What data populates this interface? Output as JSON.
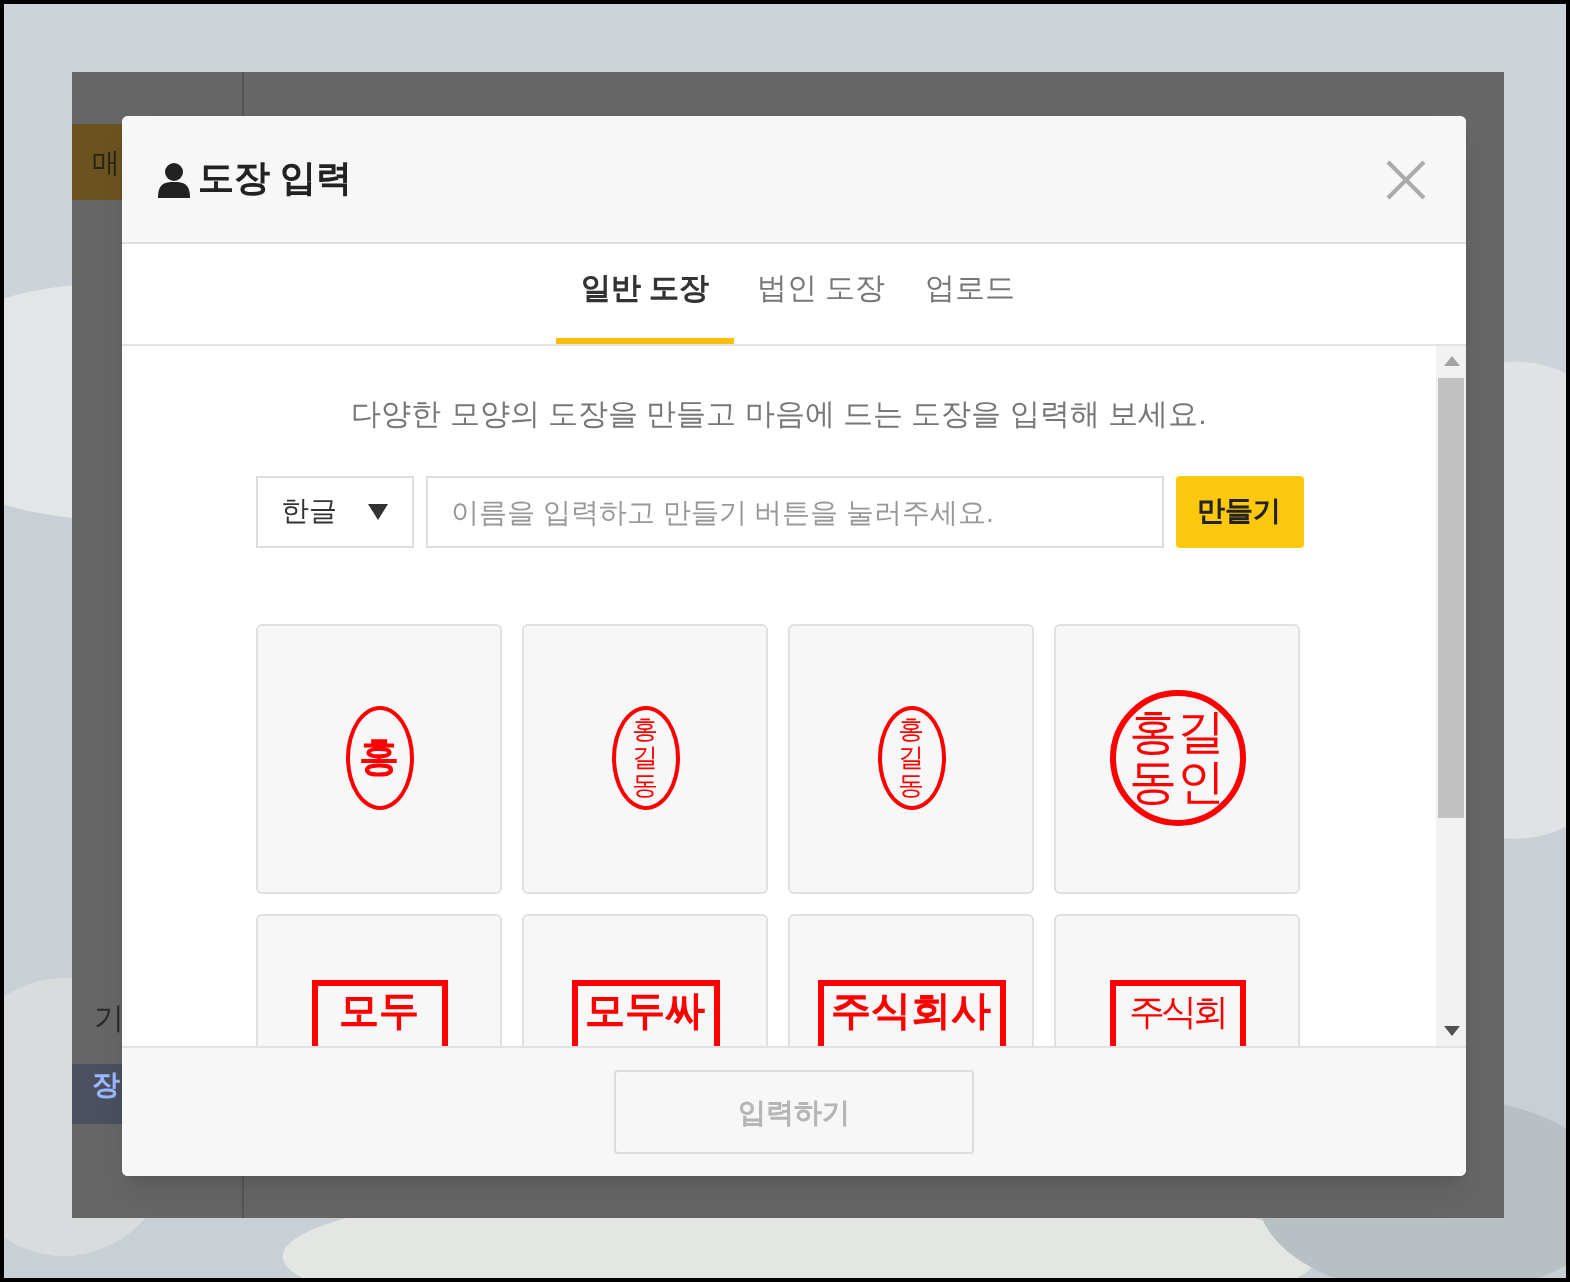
{
  "app_behind": {
    "items": [
      {
        "kind": "button",
        "label": "매"
      },
      {
        "kind": "text",
        "label": "기"
      },
      {
        "kind": "link",
        "label": "장"
      }
    ]
  },
  "modal": {
    "title": "도장 입력",
    "tabs": [
      {
        "label": "일반 도장",
        "selected": true
      },
      {
        "label": "법인 도장",
        "selected": false
      },
      {
        "label": "업로드",
        "selected": false
      }
    ],
    "description": "다양한 모양의 도장을 만들고 마음에 드는 도장을 입력해 보세요.",
    "language_select": {
      "value": "한글"
    },
    "name_field": {
      "placeholder": "이름을 입력하고 만들기 버튼을 눌러주세요."
    },
    "create_button": "만들기",
    "stamps": [
      {
        "kind": "ovalbold",
        "text": "홍"
      },
      {
        "kind": "ovalcolumn",
        "text": "홍길동"
      },
      {
        "kind": "ovalcolumn",
        "text": "홍길동"
      },
      {
        "kind": "circlegrid",
        "text": "홍길동인"
      },
      {
        "kind": "squarebold",
        "text": "모두"
      },
      {
        "kind": "squarebold",
        "text": "모두싸"
      },
      {
        "kind": "squarebold",
        "text": "주식회사"
      },
      {
        "kind": "squarethin",
        "text": "주식회"
      }
    ],
    "submit_button": {
      "label": "입력하기",
      "disabled": true
    }
  }
}
